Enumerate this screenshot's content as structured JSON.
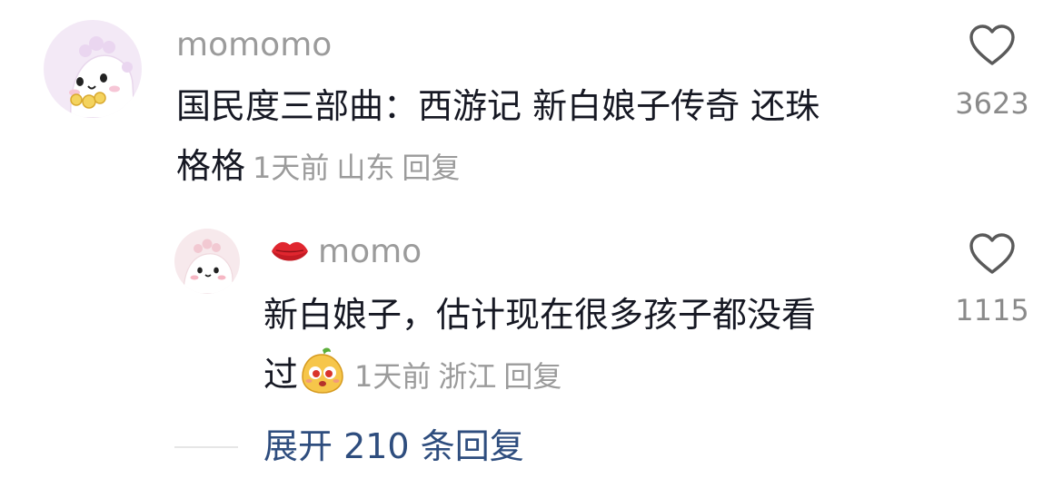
{
  "comment": {
    "username": "momomo",
    "text_line1": "国民度三部曲：西游记 新白娘子传奇 还珠",
    "text_line2": "格格",
    "time": "1天前",
    "location": "山东",
    "reply_label": "回复",
    "like_count": "3623",
    "avatar_icon": "cartoon-dinosaur-avatar"
  },
  "reply": {
    "username_prefix_icon": "lips-emoji",
    "username": "momo",
    "text_line1": "新白娘子，估计现在很多孩子都没看",
    "text_line2": "过",
    "inline_emoji_icon": "cute-face-emoji",
    "time": "1天前",
    "location": "浙江",
    "reply_label": "回复",
    "like_count": "1115",
    "avatar_icon": "cartoon-dinosaur-avatar"
  },
  "expand": {
    "label": "展开 210 条回复"
  },
  "colors": {
    "primary_text": "#161823",
    "secondary_text": "#9b9b9b",
    "link": "#2e4d7e"
  }
}
